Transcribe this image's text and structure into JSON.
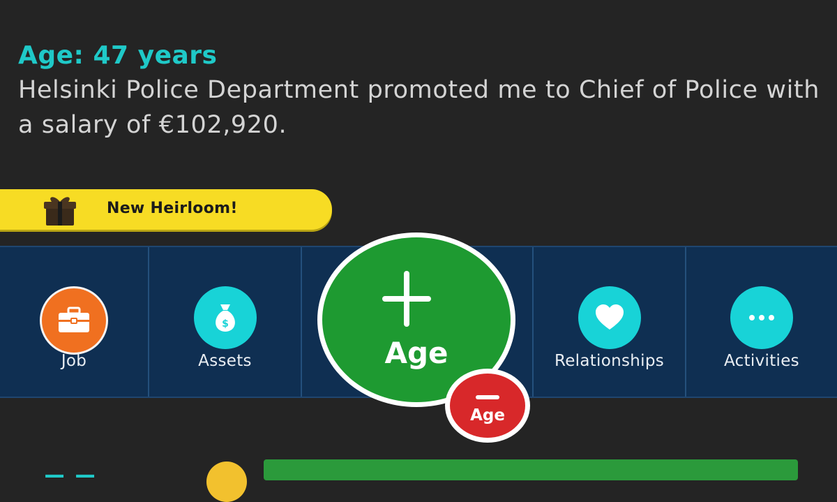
{
  "event": {
    "age_line": "Age: 47 years",
    "description": "Helsinki Police Department promoted me to Chief of Police with a salary of €102,920."
  },
  "heirloom_banner": {
    "label": "New Heirloom!",
    "icon": "gift-icon",
    "color": "#f7dc24"
  },
  "navbar": {
    "items": [
      {
        "label": "Job",
        "icon": "briefcase-icon",
        "color": "#f07020"
      },
      {
        "label": "Assets",
        "icon": "money-bag-icon",
        "color": "#18d3d7"
      },
      {
        "label": "Relationships",
        "icon": "heart-icon",
        "color": "#18d3d7"
      },
      {
        "label": "Activities",
        "icon": "ellipsis-icon",
        "color": "#18d3d7"
      }
    ]
  },
  "age_button": {
    "label": "Age",
    "icon": "plus-icon",
    "color": "#1e9a31"
  },
  "age_down_button": {
    "label": "Age",
    "icon": "minus-icon",
    "color": "#d8282a"
  },
  "colors": {
    "background": "#242424",
    "navbar": "#0f2f52",
    "accent_cyan": "#1fc9c8"
  }
}
